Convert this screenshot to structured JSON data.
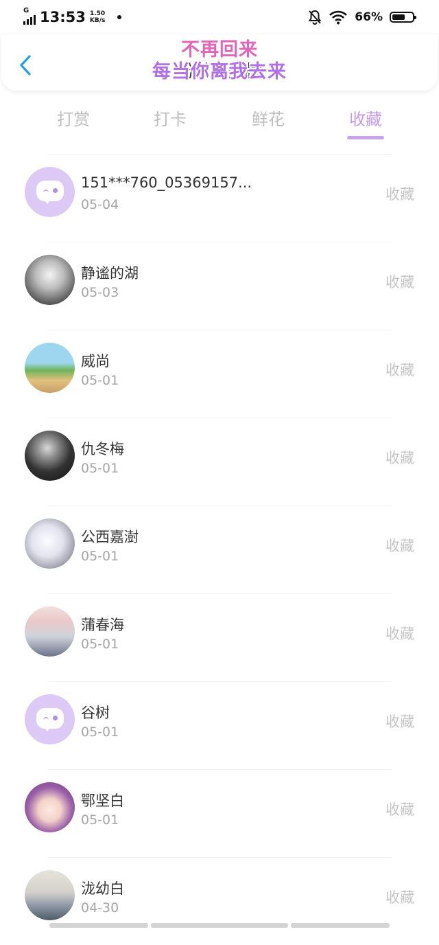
{
  "status_bar": {
    "network": "G",
    "time": "13:53",
    "speed_value": "1.50",
    "speed_unit": "KB/s",
    "battery_percent": "66%",
    "battery_level": 0.66
  },
  "header": {
    "title": "粉丝贡献榜",
    "watermark_line1": "不再回来",
    "watermark_line2": "每当你离我去来"
  },
  "tabs": [
    {
      "label": "打赏",
      "active": false
    },
    {
      "label": "打卡",
      "active": false
    },
    {
      "label": "鲜花",
      "active": false
    },
    {
      "label": "收藏",
      "active": true
    }
  ],
  "list": [
    {
      "name": "151***760_05369157...",
      "date": "05-04",
      "action": "收藏",
      "avatar": "default-chat-avatar"
    },
    {
      "name": "静谧的湖",
      "date": "05-03",
      "action": "收藏",
      "avatar": "photo-avatar"
    },
    {
      "name": "威尚",
      "date": "05-01",
      "action": "收藏",
      "avatar": "cartoon-avatar"
    },
    {
      "name": "仇冬梅",
      "date": "05-01",
      "action": "收藏",
      "avatar": "photo-avatar"
    },
    {
      "name": "公西嘉澍",
      "date": "05-01",
      "action": "收藏",
      "avatar": "anime-avatar"
    },
    {
      "name": "蒲春海",
      "date": "05-01",
      "action": "收藏",
      "avatar": "photo-avatar"
    },
    {
      "name": "谷树",
      "date": "05-01",
      "action": "收藏",
      "avatar": "default-chat-avatar"
    },
    {
      "name": "鄂坚白",
      "date": "05-01",
      "action": "收藏",
      "avatar": "anime-avatar"
    },
    {
      "name": "泷幼白",
      "date": "04-30",
      "action": "收藏",
      "avatar": "photo-avatar"
    }
  ],
  "colors": {
    "accent": "#c49ae8",
    "back_arrow": "#2a9de8",
    "tab_inactive": "#bdbdbd",
    "action_text": "#c4c4c4",
    "date_text": "#a5a5a5",
    "default_avatar_bg": "#ddc9f5"
  }
}
